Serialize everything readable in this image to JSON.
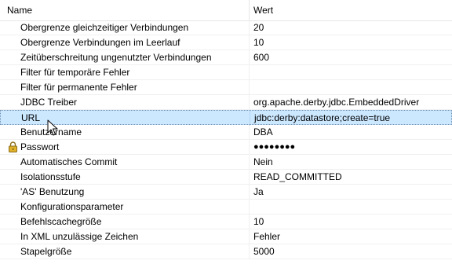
{
  "header": {
    "name_label": "Name",
    "value_label": "Wert"
  },
  "rows": [
    {
      "name": "Obergrenze gleichzeitiger Verbindungen",
      "value": "20"
    },
    {
      "name": "Obergrenze Verbindungen im Leerlauf",
      "value": "10"
    },
    {
      "name": "Zeitüberschreitung ungenutzter Verbindungen",
      "value": "600"
    },
    {
      "name": "Filter für temporäre Fehler",
      "value": ""
    },
    {
      "name": "Filter für permanente Fehler",
      "value": ""
    },
    {
      "name": "JDBC Treiber",
      "value": "org.apache.derby.jdbc.EmbeddedDriver"
    },
    {
      "name": "URL",
      "value": "jdbc:derby:datastore;create=true"
    },
    {
      "name": "Benutzername",
      "value": "DBA"
    },
    {
      "name": "Passwort",
      "value": "●●●●●●●●",
      "icon": "lock-icon"
    },
    {
      "name": "Automatisches Commit",
      "value": "Nein"
    },
    {
      "name": "Isolationsstufe",
      "value": "READ_COMMITTED"
    },
    {
      "name": "'AS' Benutzung",
      "value": "Ja"
    },
    {
      "name": "Konfigurationsparameter",
      "value": ""
    },
    {
      "name": "Befehlscachegröße",
      "value": "10"
    },
    {
      "name": "In XML unzulässige Zeichen",
      "value": "Fehler"
    },
    {
      "name": "Stapelgröße",
      "value": "5000"
    }
  ],
  "selected_row": "URL",
  "colors": {
    "selection": "#cce8ff",
    "selection_border": "#6f8fb3",
    "lock_body": "#d4a017"
  }
}
